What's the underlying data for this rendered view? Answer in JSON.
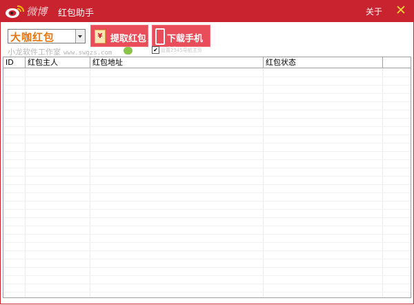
{
  "titlebar": {
    "logo_text": "微博",
    "app_title": "红包助手",
    "about_label": "关于",
    "close_glyph": "✕",
    "bg_color": "#c9232f",
    "close_color": "#f4d23a"
  },
  "toolbar": {
    "select_value": "大咖红包",
    "extract_label": "提取红包",
    "extract_icon": "¥",
    "mobile_label": "下载手机版",
    "credit_text": "小龙软件工作室",
    "credit_site": "www.swgzs.com",
    "checkbox_mark": "✔",
    "checkbox_label": "设置2345导航主页",
    "button_color": "#e94d59"
  },
  "table": {
    "columns": [
      "ID",
      "红包主人",
      "红包地址",
      "红包状态"
    ],
    "rows": []
  }
}
